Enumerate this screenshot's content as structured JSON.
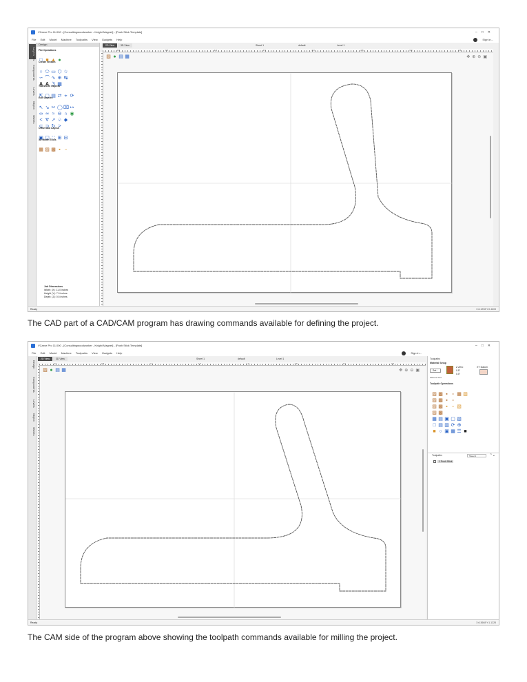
{
  "shot1": {
    "title": "VCarve Pro 11.000 - [Consultingwoodworker - Knight Magnet] - [Push Stick Template]",
    "menu": [
      "File",
      "Edit",
      "Model",
      "Machine",
      "Toolpaths",
      "View",
      "Gadgets",
      "Help"
    ],
    "signin": "Sign in...",
    "pane_header": "Design",
    "vtabs": [
      "Layers",
      "Components",
      "Levels",
      "Object",
      "Sheets"
    ],
    "view_tabs": [
      "2D View",
      "3D View"
    ],
    "sheet": "Sheet 1",
    "layer": "default",
    "level": "Level 1",
    "sections": [
      "File Operations",
      "Create Vectors",
      "Transform Objects",
      "Edit Objects",
      "Offset and Layout",
      "3D Model Tools"
    ],
    "job_dims": {
      "title": "Job Dimensions",
      "width": "Width: (X): 11.0 inches",
      "height": "Height (Y): 7.0 inches",
      "depth": "Depth: (Z): 0.5 inches"
    },
    "status_left": "Ready",
    "status_right": "X:6.1298 Y:0.4603",
    "ruler_labels": [
      "-0.0",
      "0.5",
      "1.0",
      "1.5",
      "2.0",
      "2.5",
      "3.0",
      "3.5"
    ],
    "right_tab": "Toolpaths"
  },
  "shot2": {
    "title": "VCarve Pro 11.000 - [Consultingwoodworker - Knight Magnet] - [Push Stick Template]",
    "menu": [
      "File",
      "Edit",
      "Model",
      "Machine",
      "Toolpaths",
      "View",
      "Gadgets",
      "Help"
    ],
    "signin": "Sign in...",
    "vtabs": [
      "Design",
      "Components",
      "Levels",
      "Object",
      "Sheets"
    ],
    "view_tabs": [
      "2D View",
      "3D View"
    ],
    "sheet": "Sheet 1",
    "layer": "default",
    "level": "Level 1",
    "right_panel": {
      "title": "Toolpaths",
      "material_setup": "Material Setup",
      "set_button": "Set...",
      "z_zero": "Z Zero",
      "thickness_a": "0.5\"",
      "thickness_b": "0.0\"",
      "material_size": "Material Size",
      "xy_datum": "XY Datum",
      "toolpath_operations": "Toolpath Operations",
      "toolpaths_header": "Toolpaths",
      "sheet_select": "Sheet 1",
      "toolpath_item": "1 Push Stick"
    },
    "status_left": "Ready",
    "status_right": "X:6.3668 Y:1.1228",
    "ruler_labels": [
      "-0.0",
      "0.5",
      "1.0",
      "1.5",
      "2.0",
      "2.5",
      "3.0",
      "3.5"
    ]
  },
  "captions": {
    "cad": "The CAD part of a CAD/CAM program has drawing commands available for defining the project.",
    "cam": "The CAM side of the program above showing the toolpath commands available for milling the project."
  },
  "colors": {
    "accent_blue": "#2a63c6",
    "active_tab": "#4a4a4a",
    "outline": "#6a6a6a"
  },
  "icons": [
    "app-icon",
    "user-avatar-icon",
    "minimize-icon",
    "maximize-icon",
    "close-icon",
    "pan-icon",
    "zoom-in-icon",
    "zoom-out-icon",
    "zoom-extents-icon"
  ]
}
